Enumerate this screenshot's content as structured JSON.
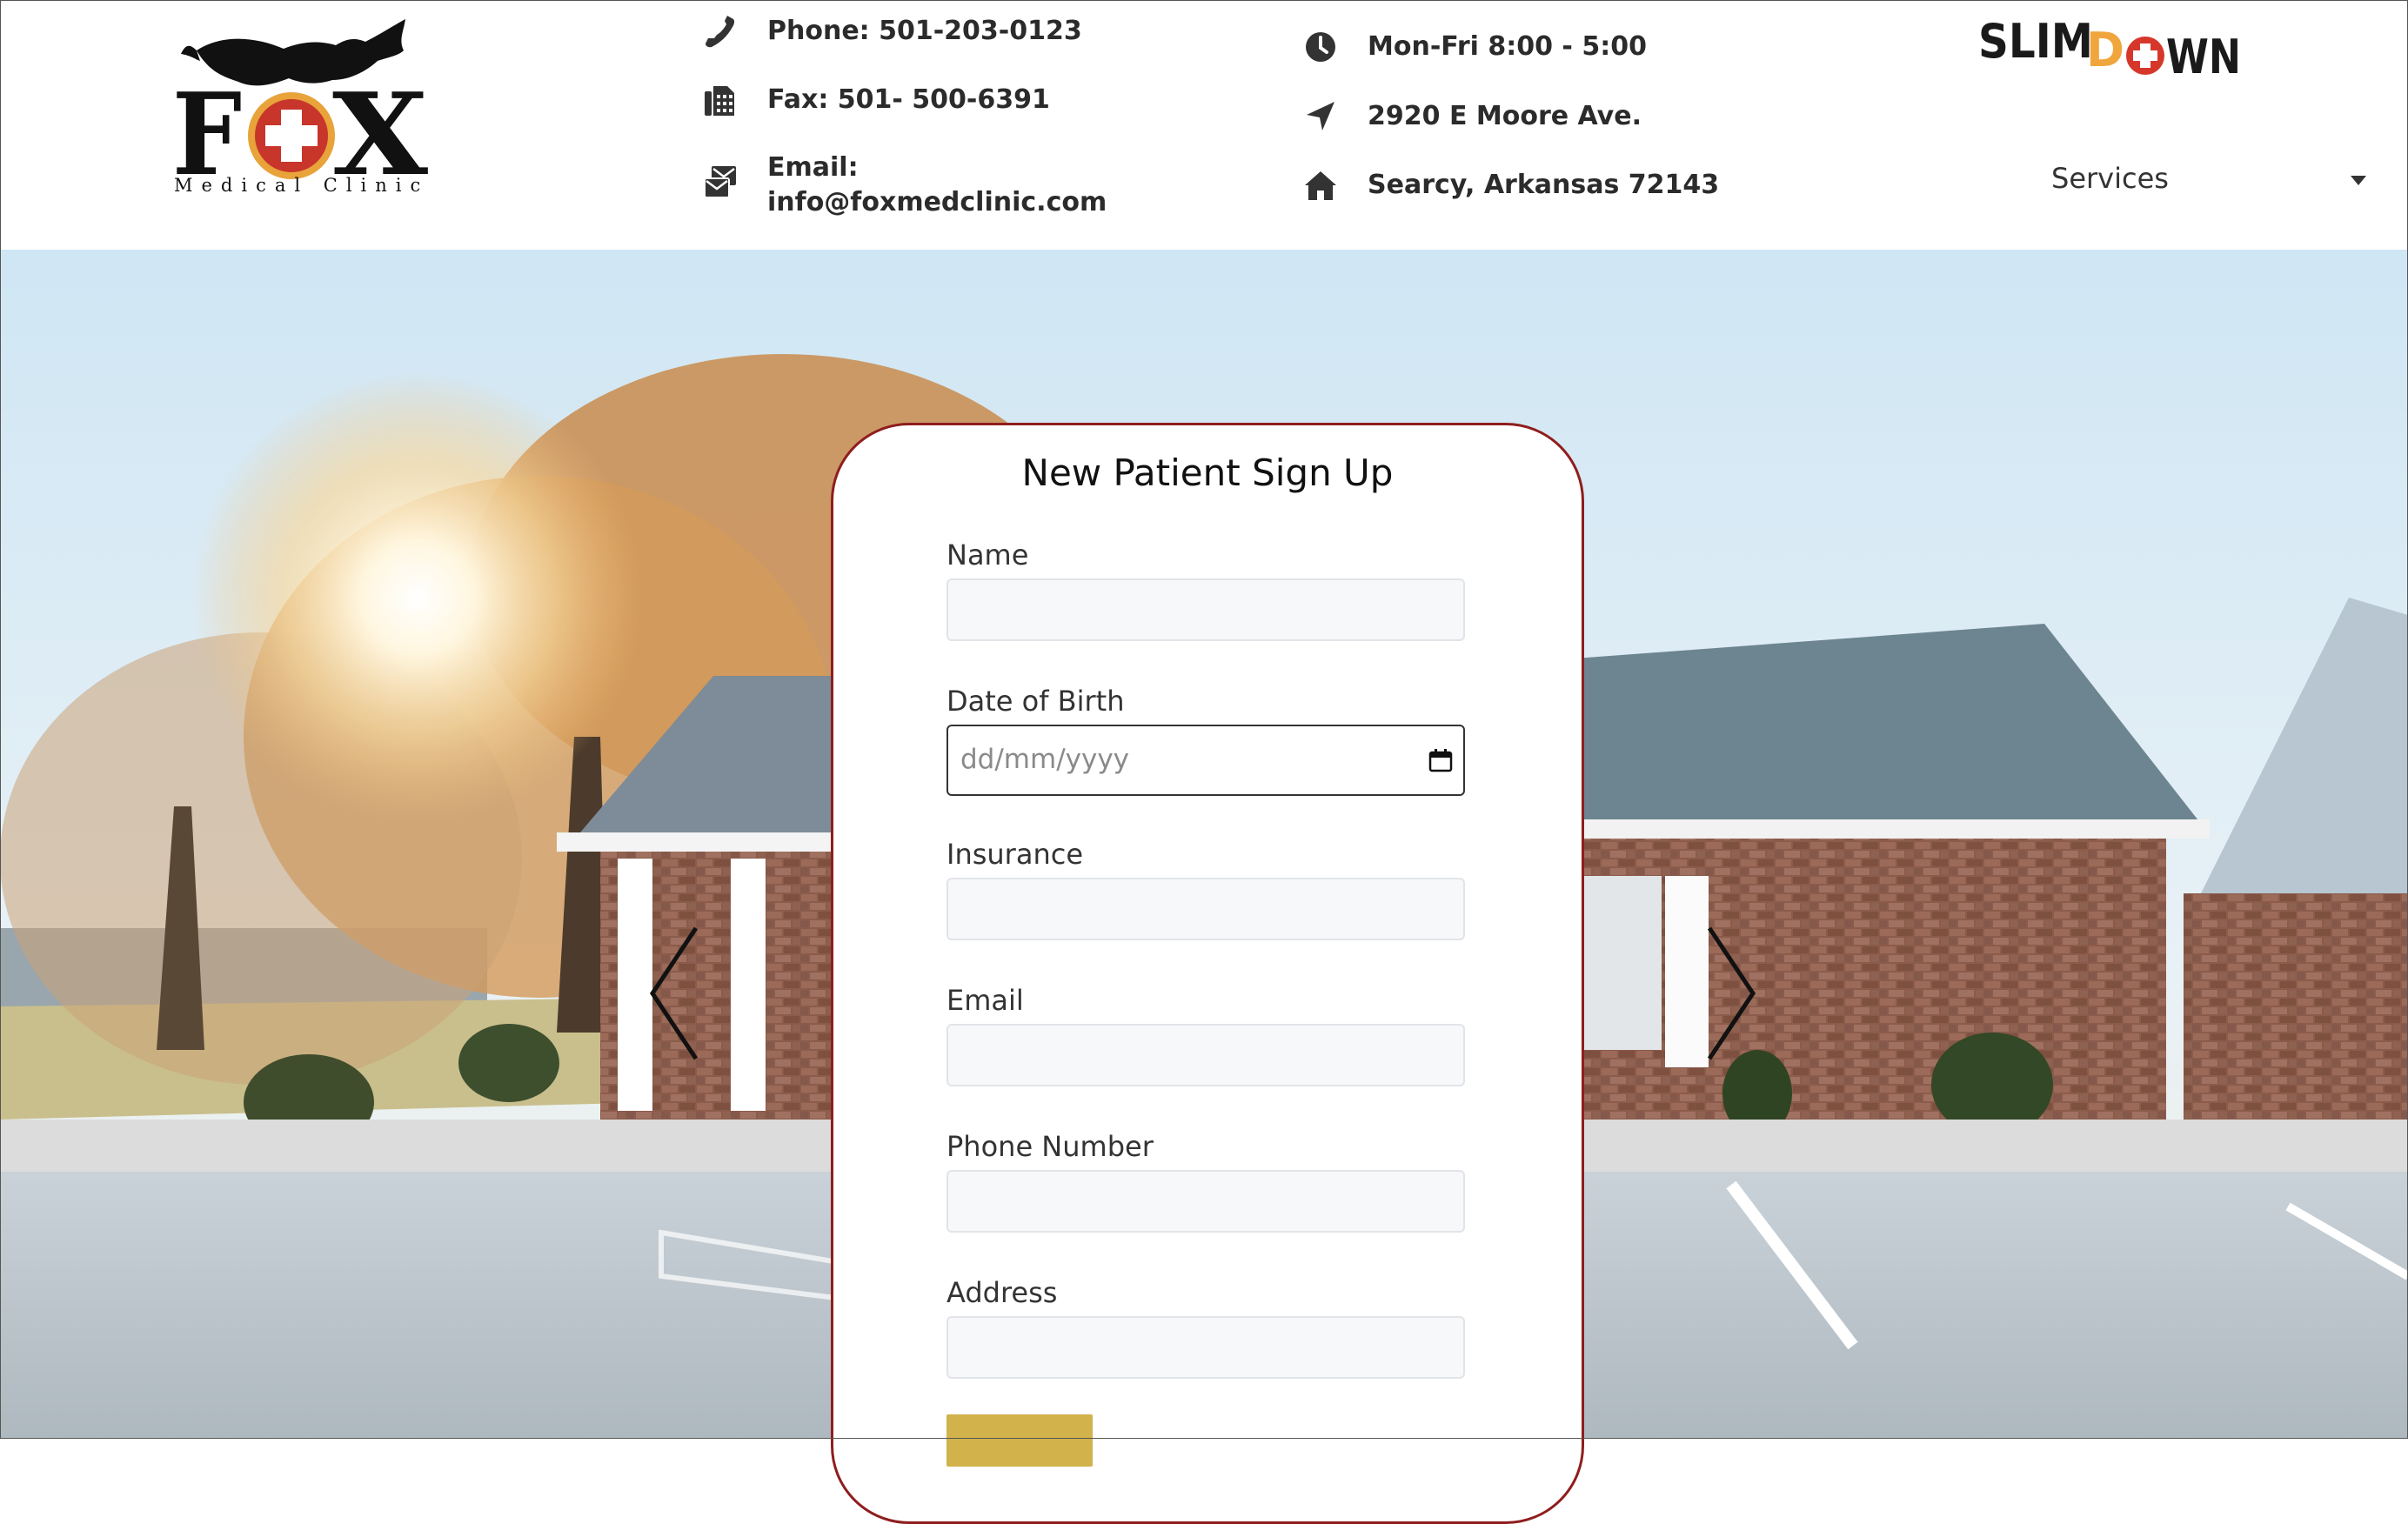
{
  "header": {
    "logo": {
      "word": "FOX",
      "tagline": "Medical Clinic"
    },
    "contact": {
      "phone": "Phone: 501-203-0123",
      "fax": "Fax: 501- 500-6391",
      "email_label": "Email:",
      "email_value": "info@foxmedclinic.com"
    },
    "location": {
      "hours": "Mon-Fri 8:00 - 5:00",
      "street": "2920 E Moore Ave.",
      "city": "Searcy, Arkansas 72143"
    },
    "partner_logo": "SLIMDOWN",
    "nav": {
      "services_label": "Services"
    }
  },
  "form": {
    "title": "New Patient Sign Up",
    "fields": [
      {
        "label": "Name",
        "value": ""
      },
      {
        "label": "Date of Birth",
        "placeholder": "dd/mm/yyyy"
      },
      {
        "label": "Insurance",
        "value": ""
      },
      {
        "label": "Email",
        "value": ""
      },
      {
        "label": "Phone Number",
        "value": ""
      },
      {
        "label": "Address",
        "value": ""
      }
    ]
  },
  "colors": {
    "card_border": "#8f1d1d",
    "logo_red": "#c8352b",
    "logo_orange": "#e8a33a",
    "submit_button": "#d1b24b"
  },
  "icons": [
    "phone-icon",
    "fax-icon",
    "email-icon",
    "clock-icon",
    "location-arrow-icon",
    "home-icon",
    "chevron-down-icon",
    "calendar-icon",
    "chevron-left-icon",
    "chevron-right-icon"
  ]
}
